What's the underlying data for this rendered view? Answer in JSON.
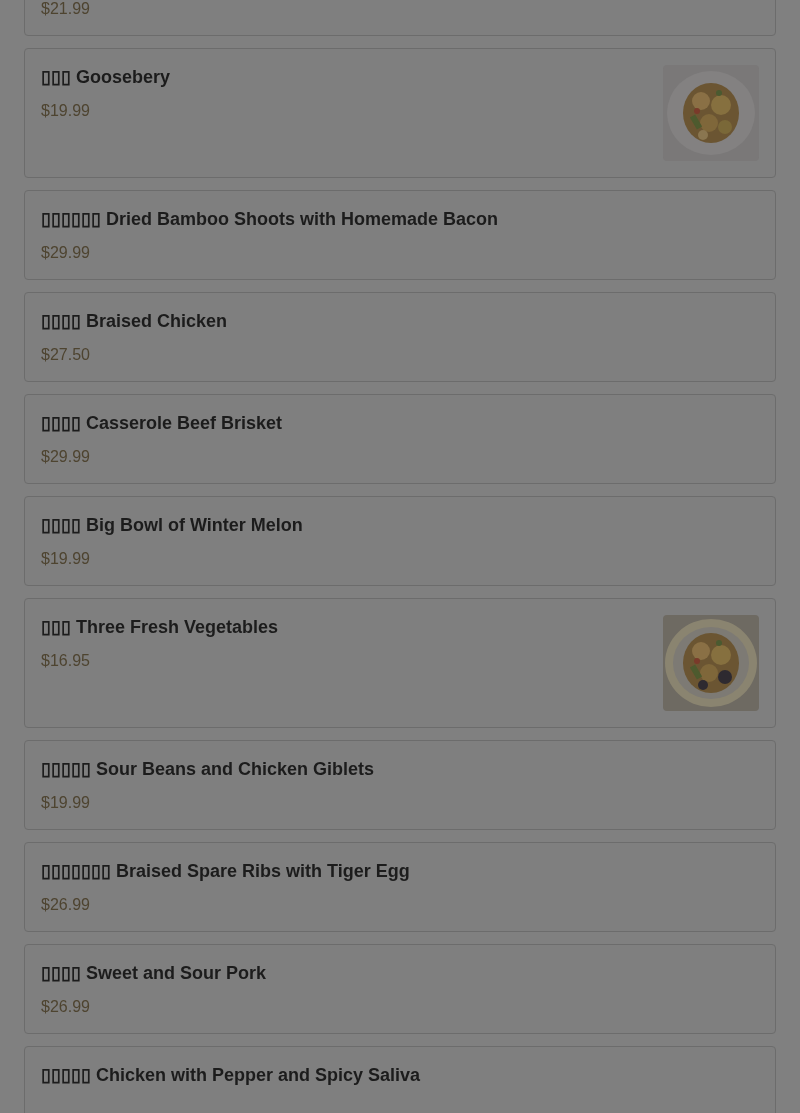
{
  "menu_items": [
    {
      "price": "$21.99"
    },
    {
      "name": "▯▯▯ Goosebery",
      "price": "$19.99"
    },
    {
      "name": "▯▯▯▯▯▯ Dried Bamboo Shoots with Homemade Bacon",
      "price": "$29.99"
    },
    {
      "name": "▯▯▯▯ Braised Chicken",
      "price": "$27.50"
    },
    {
      "name": "▯▯▯▯ Casserole Beef Brisket",
      "price": "$29.99"
    },
    {
      "name": "▯▯▯▯ Big Bowl of Winter Melon",
      "price": "$19.99"
    },
    {
      "name": "▯▯▯ Three Fresh Vegetables",
      "price": "$16.95"
    },
    {
      "name": "▯▯▯▯▯ Sour Beans and Chicken Giblets",
      "price": "$19.99"
    },
    {
      "name": "▯▯▯▯▯▯▯ Braised Spare Ribs with Tiger Egg",
      "price": "$26.99"
    },
    {
      "name": "▯▯▯▯ Sweet and Sour Pork",
      "price": "$26.99"
    },
    {
      "name": "▯▯▯▯▯ Chicken with Pepper and Spicy Saliva"
    }
  ]
}
